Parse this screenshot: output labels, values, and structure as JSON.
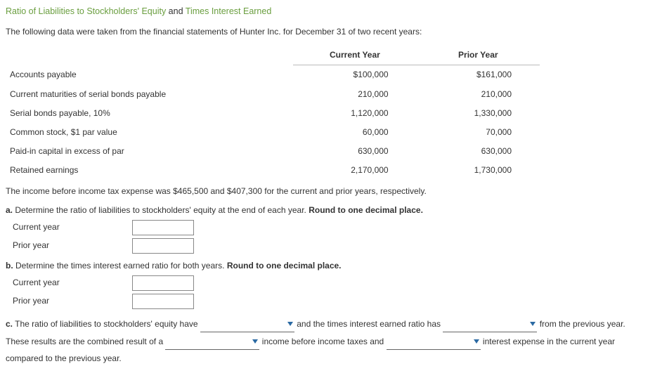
{
  "title_part1": "Ratio of Liabilities to Stockholders' Equity ",
  "title_and": "and ",
  "title_part2": "Times Interest Earned",
  "intro": "The following data were taken from the financial statements of Hunter Inc. for December 31 of two recent years:",
  "table": {
    "headers": [
      "",
      "Current Year",
      "Prior Year"
    ],
    "rows": [
      {
        "label": "Accounts payable",
        "cy": "$100,000",
        "py": "$161,000"
      },
      {
        "label": "Current maturities of serial bonds payable",
        "cy": "210,000",
        "py": "210,000"
      },
      {
        "label": "Serial bonds payable, 10%",
        "cy": "1,120,000",
        "py": "1,330,000"
      },
      {
        "label": "Common stock, $1 par value",
        "cy": "60,000",
        "py": "70,000"
      },
      {
        "label": "Paid-in capital in excess of par",
        "cy": "630,000",
        "py": "630,000"
      },
      {
        "label": "Retained earnings",
        "cy": "2,170,000",
        "py": "1,730,000"
      }
    ]
  },
  "income_note": "The income before income tax expense was $465,500 and $407,300 for the current and prior years, respectively.",
  "qa": {
    "letter": "a.",
    "text_pre": "  Determine the ratio of liabilities to stockholders' equity at the end of each year. ",
    "text_bold": "Round to one decimal place."
  },
  "labels": {
    "current_year": "Current year",
    "prior_year": "Prior year"
  },
  "qb": {
    "letter": "b.",
    "text_pre": "  Determine the times interest earned ratio for both years. ",
    "text_bold": "Round to one decimal place."
  },
  "qc": {
    "letter": "c.",
    "seg1": " The ratio of liabilities to stockholders' equity have ",
    "seg2": " and the times interest earned ratio has ",
    "seg3": " from the previous year. These results are the combined result of a ",
    "seg4": " income before income taxes and ",
    "seg5": " interest expense in the current year compared to the previous year."
  }
}
